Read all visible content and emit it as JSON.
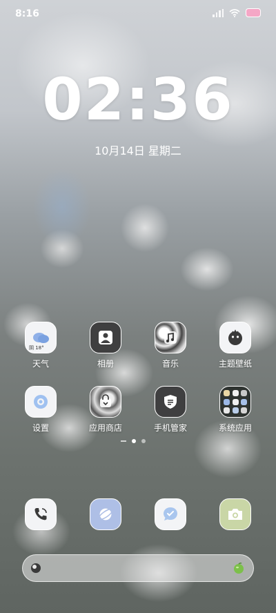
{
  "status": {
    "time": "8:16"
  },
  "lockscreen": {
    "clock": "02:36",
    "date": "10月14日  星期二"
  },
  "apps_row1": [
    {
      "label": "天气",
      "icon": "weather-icon",
      "badge": "阴 18°"
    },
    {
      "label": "相册",
      "icon": "gallery-icon"
    },
    {
      "label": "音乐",
      "icon": "music-icon"
    },
    {
      "label": "主题壁纸",
      "icon": "themes-icon"
    }
  ],
  "apps_row2": [
    {
      "label": "设置",
      "icon": "settings-icon"
    },
    {
      "label": "应用商店",
      "icon": "app-store-icon"
    },
    {
      "label": "手机管家",
      "icon": "security-icon"
    },
    {
      "label": "系统应用",
      "icon": "system-apps-folder-icon"
    }
  ],
  "dock": [
    {
      "icon": "phone-icon"
    },
    {
      "icon": "browser-icon"
    },
    {
      "icon": "messages-icon"
    },
    {
      "icon": "camera-icon"
    }
  ],
  "colors": {
    "battery": "#f5a7c6",
    "weather_cloud": "#8fb0e8",
    "browser": "#aebfe6",
    "messages": "#a9c6ee",
    "camera": "#c9d6a6",
    "settings": "#9fc1f0"
  }
}
